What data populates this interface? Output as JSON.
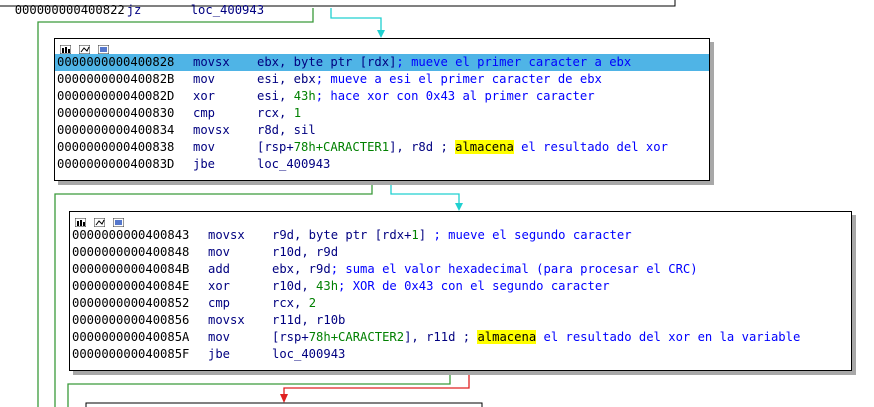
{
  "top_partial": {
    "addr": "000000000400822",
    "mnem": "jz",
    "op": "loc_400943"
  },
  "node1": {
    "lines": [
      {
        "addr": "0000000000400828",
        "mnem": "movsx",
        "op1": "ebx, byte ptr [rdx]",
        "comment": "; mueve el primer caracter a ebx"
      },
      {
        "addr": "000000000040082B",
        "mnem": "mov",
        "op1": "esi, ebx",
        "comment": "; mueve a esi el primer caracter de ebx"
      },
      {
        "addr": "000000000040082D",
        "mnem": "xor",
        "op1": "esi, ",
        "num": "43h",
        "comment": "; hace xor con 0x43 al primer caracter"
      },
      {
        "addr": "0000000000400830",
        "mnem": "cmp",
        "op1": "rcx, ",
        "num": "1"
      },
      {
        "addr": "0000000000400834",
        "mnem": "movsx",
        "op1": "r8d, sil"
      },
      {
        "addr": "0000000000400838",
        "mnem": "mov",
        "op1": "[rsp+",
        "num": "78h",
        "sym": "+CARACTER1",
        "op2": "], r8d ; ",
        "hl": "almacena",
        "comment": " el resultado del xor"
      },
      {
        "addr": "000000000040083D",
        "mnem": "jbe",
        "op1": "loc_400943"
      }
    ]
  },
  "node2": {
    "lines": [
      {
        "addr": "0000000000400843",
        "mnem": "movsx",
        "op1": "r9d, byte ptr [rdx+",
        "num": "1",
        "op2": "]",
        "comment": " ; mueve el segundo caracter"
      },
      {
        "addr": "0000000000400848",
        "mnem": "mov",
        "op1": "r10d, r9d"
      },
      {
        "addr": "000000000040084B",
        "mnem": "add",
        "op1": "ebx, r9d",
        "comment": "; suma el valor hexadecimal (para procesar el CRC)"
      },
      {
        "addr": "000000000040084E",
        "mnem": "xor",
        "op1": "r10d, ",
        "num": "43h",
        "comment": "; XOR de 0x43 con el segundo caracter"
      },
      {
        "addr": "0000000000400852",
        "mnem": "cmp",
        "op1": "rcx, ",
        "num": "2"
      },
      {
        "addr": "0000000000400856",
        "mnem": "movsx",
        "op1": "r11d, r10b"
      },
      {
        "addr": "000000000040085A",
        "mnem": "mov",
        "op1": "[rsp+",
        "num": "78h",
        "sym": "+CARACTER2",
        "op2": "], r11d ; ",
        "hl": "almacena",
        "comment": " el resultado del xor en la variable"
      },
      {
        "addr": "000000000040085F",
        "mnem": "jbe",
        "op1": "loc_400943"
      }
    ]
  },
  "colors": {
    "edge_green": "#3a9a3a",
    "edge_cyan": "#20d0d0",
    "edge_red": "#e02020",
    "selection": "#4fb4e6"
  },
  "icons": [
    "graph-color-icon",
    "graph-collapse-icon",
    "graph-node-icon"
  ]
}
